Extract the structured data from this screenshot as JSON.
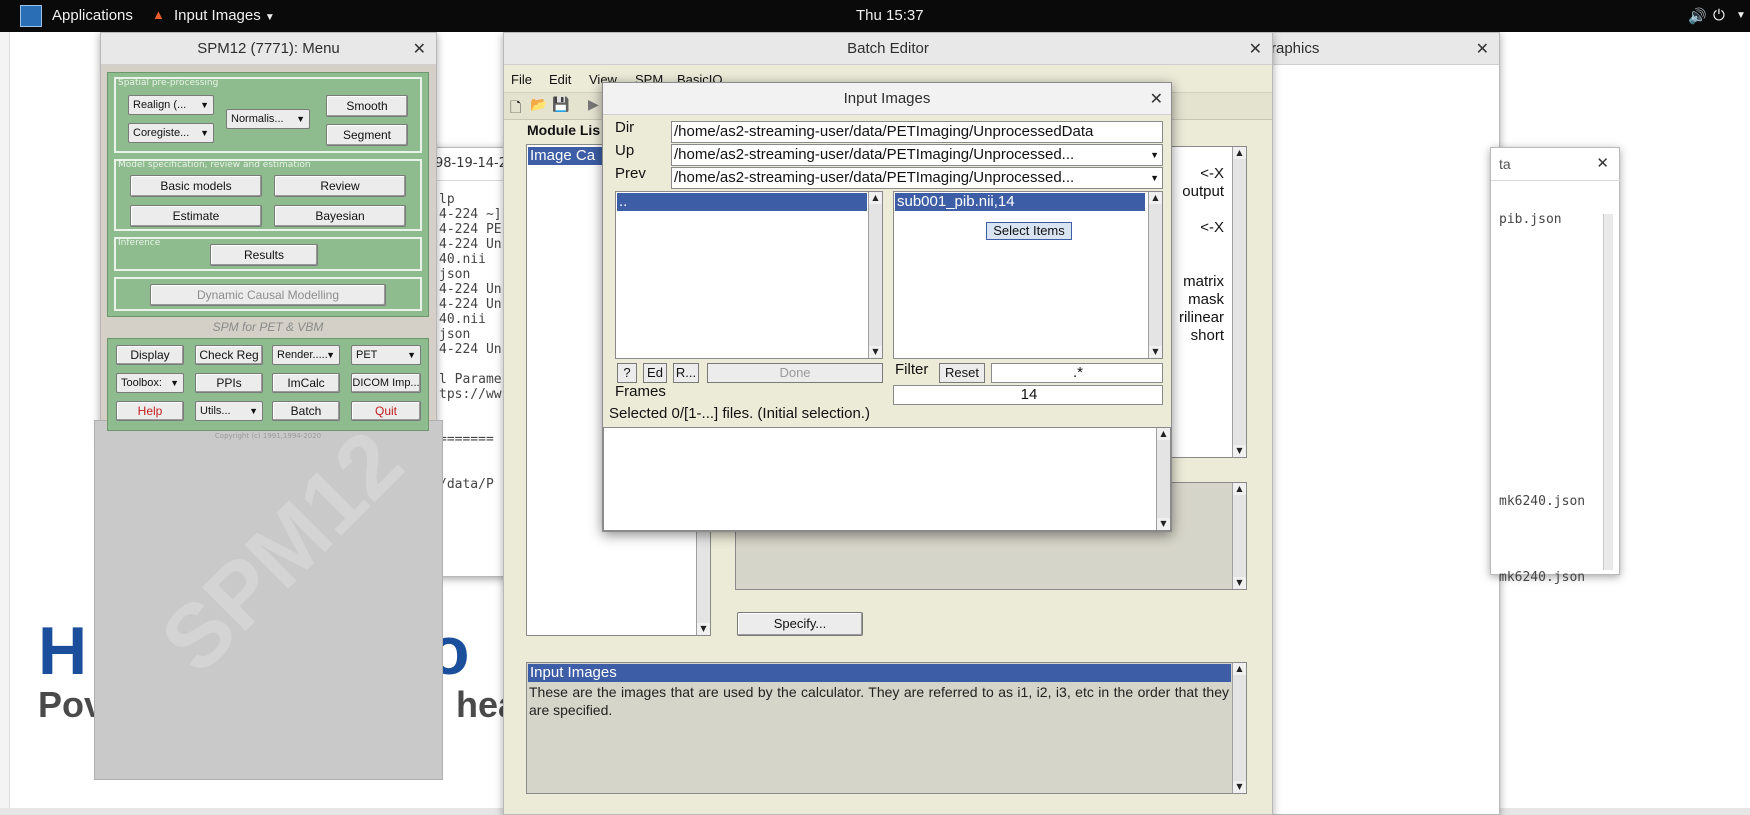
{
  "topbar": {
    "applications": "Applications",
    "app_menu": "Input Images",
    "clock": "Thu 15:37"
  },
  "desktop": {
    "title_fragment_1": "H",
    "title_fragment_2": "io",
    "sub_fragment_1": "Pov",
    "sub_fragment_2": "hea"
  },
  "bg_terminal": {
    "title_fragment": "98-19-14-2",
    "lines": [
      "lp",
      "4-224 ~]",
      "4-224 PE",
      "4-224 Un",
      "40.nii",
      "json",
      "4-224 Un",
      "4-224 Un",
      "40.nii",
      "json",
      "4-224 Un",
      "",
      "l Parame",
      "tps://ww",
      "",
      "",
      "=======",
      "",
      "",
      "/data/P"
    ]
  },
  "graphics_win": {
    "title_fragment": "raphics"
  },
  "right_win": {
    "title_fragment": "ta",
    "lines": [
      "pib.json",
      "mk6240.json",
      "mk6240.json"
    ]
  },
  "spm_menu": {
    "title": "SPM12 (7771): Menu",
    "section_spatial": "Spatial pre-processing",
    "realign": "Realign (...",
    "coregister": "Coregiste...",
    "normalise": "Normalis...",
    "smooth": "Smooth",
    "segment": "Segment",
    "section_model": "Model specification, review and estimation",
    "basic_models": "Basic models",
    "review": "Review",
    "estimate": "Estimate",
    "bayesian": "Bayesian",
    "section_inference": "Inference",
    "results": "Results",
    "dcm": "Dynamic Causal Modelling",
    "caption": "SPM for PET & VBM",
    "display": "Display",
    "check_reg": "Check Reg",
    "render": "Render.....",
    "modality": "PET",
    "toolbox": "Toolbox:",
    "ppis": "PPIs",
    "imcalc": "ImCalc",
    "dicom": "DICOM Imp...",
    "help": "Help",
    "utils": "Utils...",
    "batch": "Batch",
    "quit": "Quit",
    "copyright": "Copyright (c) 1991,1994-2020",
    "watermark": "SPM12"
  },
  "batch_editor": {
    "title": "Batch Editor",
    "menu": [
      "File",
      "Edit",
      "View",
      "SPM",
      "BasicIO"
    ],
    "module_list_label": "Module Lis",
    "module_item": "Image Ca",
    "right_lines": [
      "<-X",
      "output",
      "<-X",
      "matrix",
      "mask",
      "rilinear",
      "short"
    ],
    "specify": "Specify...",
    "help_title": "Input Images",
    "help_text": "These  are  the  images  that are used by the calculator.  They are referred to as i1, i2, i3, etc in the order that they are specified."
  },
  "dialog": {
    "title": "Input Images",
    "dir_label": "Dir",
    "dir_value": "/home/as2-streaming-user/data/PETImaging/UnprocessedData",
    "up_label": "Up",
    "up_value": "/home/as2-streaming-user/data/PETImaging/Unprocessed...",
    "prev_label": "Prev",
    "prev_value": "/home/as2-streaming-user/data/PETImaging/Unprocessed...",
    "dir_list_item": "..",
    "file_list_item": "sub001_pib.nii,14",
    "select_items": "Select Items",
    "btn_help": "?",
    "btn_ed": "Ed",
    "btn_r": "R...",
    "btn_done": "Done",
    "filter_label": "Filter",
    "reset": "Reset",
    "filter_value": ".*",
    "frames_label": "Frames",
    "frames_value": "14",
    "status": "Selected 0/[1-...] files. (Initial selection.)"
  }
}
